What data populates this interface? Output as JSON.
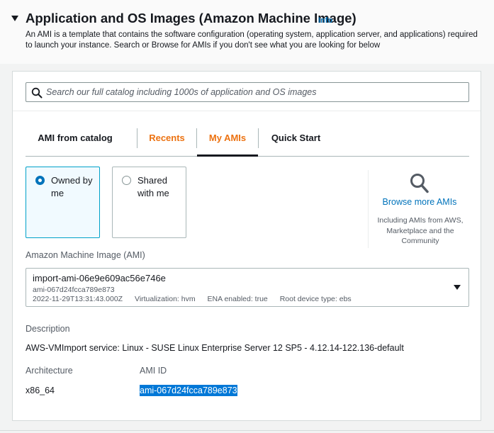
{
  "section": {
    "title": "Application and OS Images (Amazon Machine Image)",
    "info_label": "Info",
    "description": "An AMI is a template that contains the software configuration (operating system, application server, and applications) required to launch your instance. Search or Browse for AMIs if you don't see what you are looking for below"
  },
  "search": {
    "placeholder": "Search our full catalog including 1000s of application and OS images",
    "value": ""
  },
  "tabs": [
    {
      "label": "AMI from catalog",
      "active": false
    },
    {
      "label": "Recents",
      "active": false
    },
    {
      "label": "My AMIs",
      "active": true
    },
    {
      "label": "Quick Start",
      "active": false
    }
  ],
  "ownership": {
    "options": [
      {
        "label": "Owned by me",
        "selected": true
      },
      {
        "label": "Shared with me",
        "selected": false
      }
    ]
  },
  "browse": {
    "link": "Browse more AMIs",
    "note": "Including AMIs from AWS, Marketplace and the Community"
  },
  "ami_select": {
    "label": "Amazon Machine Image (AMI)",
    "name": "import-ami-06e9e609ac56e746e",
    "id": "ami-067d24fcca789e873",
    "date": "2022-11-29T13:31:43.000Z",
    "virtualization": "Virtualization: hvm",
    "ena": "ENA enabled: true",
    "root_device": "Root device type: ebs"
  },
  "details": {
    "description_label": "Description",
    "description_value": "AWS-VMImport service: Linux - SUSE Linux Enterprise Server 12 SP5 - 4.12.14-122.136-default",
    "architecture_label": "Architecture",
    "architecture_value": "x86_64",
    "ami_id_label": "AMI ID",
    "ami_id_value": "ami-067d24fcca789e873"
  },
  "colors": {
    "accent_orange": "#ec7211",
    "link_blue": "#0073bb",
    "selected_border": "#00a1c9",
    "text_highlight": "#0078d7"
  }
}
